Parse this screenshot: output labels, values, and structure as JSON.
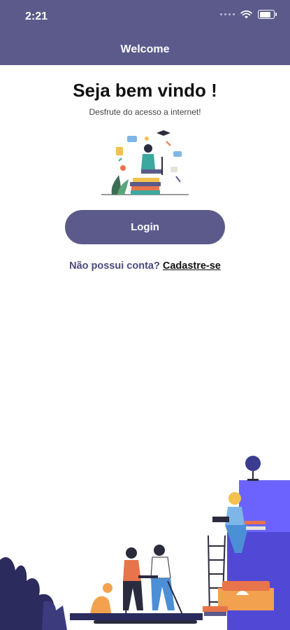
{
  "status": {
    "time": "2:21"
  },
  "header": {
    "title": "Welcome"
  },
  "main": {
    "title": "Seja bem vindo !",
    "subtitle": "Desfrute do acesso a internet!",
    "login_label": "Login",
    "signup_question": "Não possui conta?",
    "signup_link": "Cadastre-se"
  },
  "colors": {
    "primary": "#5b5a8b",
    "accent": "#6c63ff"
  },
  "icons": [
    "wifi-icon",
    "battery-icon",
    "signal-icon"
  ]
}
